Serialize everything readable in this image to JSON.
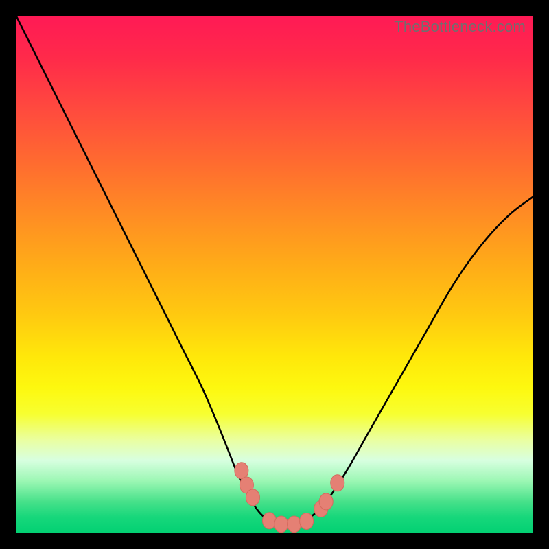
{
  "watermark": "TheBottleneck.com",
  "colors": {
    "page_bg": "#000000",
    "curve_stroke": "#000000",
    "marker_fill": "#e58074",
    "marker_stroke": "#d46a5e"
  },
  "chart_data": {
    "type": "line",
    "title": "",
    "xlabel": "",
    "ylabel": "",
    "xlim": [
      0,
      100
    ],
    "ylim": [
      0,
      100
    ],
    "grid": false,
    "legend": false,
    "x": [
      0,
      4,
      8,
      12,
      16,
      20,
      24,
      28,
      32,
      36,
      39,
      41,
      43,
      45,
      47,
      49,
      51,
      53,
      55,
      57,
      60,
      64,
      68,
      72,
      76,
      80,
      84,
      88,
      92,
      96,
      100
    ],
    "y": [
      100,
      92,
      84,
      76,
      68,
      60,
      52,
      44,
      36,
      28,
      21,
      16,
      11,
      7,
      4,
      2.2,
      1.5,
      1.5,
      2.0,
      3.0,
      6,
      12,
      19,
      26,
      33,
      40,
      47,
      53,
      58,
      62,
      65
    ],
    "markers": [
      {
        "x": 43.6,
        "y": 12.0
      },
      {
        "x": 44.6,
        "y": 9.2
      },
      {
        "x": 45.8,
        "y": 6.8
      },
      {
        "x": 49.0,
        "y": 2.3
      },
      {
        "x": 51.3,
        "y": 1.6
      },
      {
        "x": 53.8,
        "y": 1.6
      },
      {
        "x": 56.2,
        "y": 2.2
      },
      {
        "x": 59.0,
        "y": 4.6
      },
      {
        "x": 60.0,
        "y": 6.0
      },
      {
        "x": 62.2,
        "y": 9.6
      }
    ]
  }
}
